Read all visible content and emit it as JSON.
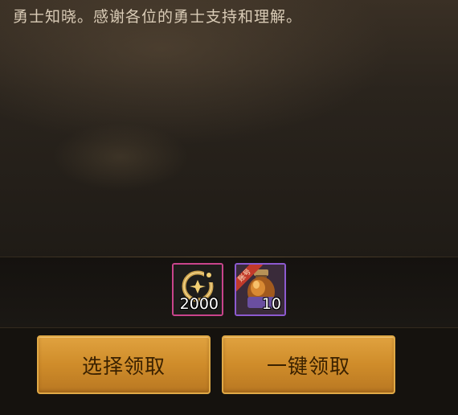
{
  "notice": {
    "text": "勇士知晓。感谢各位的勇士支持和理解。"
  },
  "rewards": [
    {
      "icon": "gold-emblem-icon",
      "count": "2000",
      "frame_color": "#c9448c"
    },
    {
      "icon": "lantern-potion-icon",
      "count": "10",
      "tag": "账号",
      "frame_color": "#8d5ad0"
    }
  ],
  "actions": {
    "select_claim_label": "选择领取",
    "claim_all_label": "一键领取",
    "button_color": "#d9962f"
  }
}
